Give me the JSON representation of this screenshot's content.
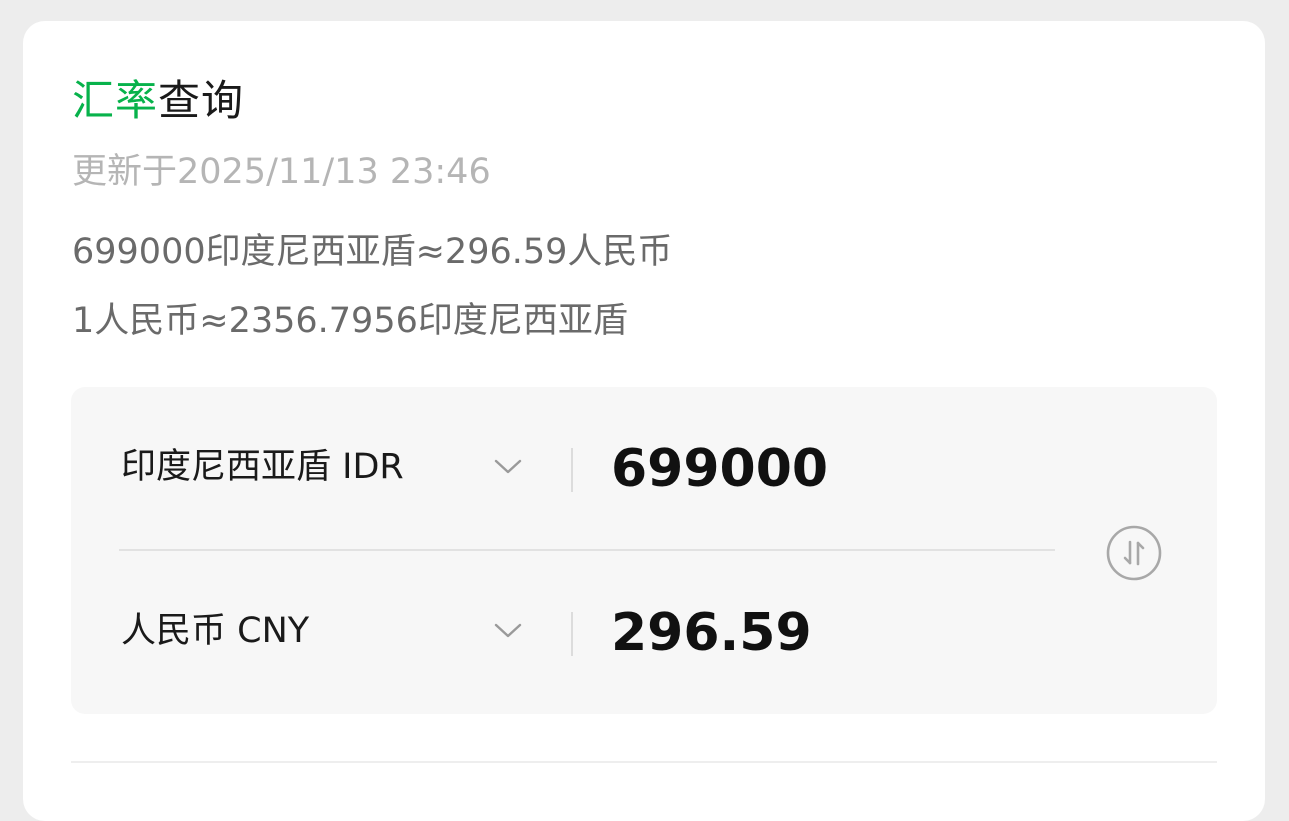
{
  "title": {
    "highlight": "汇率",
    "rest": "查询"
  },
  "updated_text": "更新于2025/11/13 23:46",
  "rates": {
    "line1": "699000印度尼西亚盾≈296.59人民币",
    "line2": "1人民币≈2356.7956印度尼西亚盾"
  },
  "converter": {
    "from": {
      "currency_label": "印度尼西亚盾 IDR",
      "amount": "699000"
    },
    "to": {
      "currency_label": "人民币 CNY",
      "amount": "296.59"
    }
  },
  "icons": {
    "chevron": "chevron-down-icon",
    "swap": "swap-vertical-icon"
  },
  "colors": {
    "accent": "#07b24b",
    "text_primary": "#111111",
    "text_muted": "#b5b5b5",
    "text_secondary": "#6a6a6a",
    "panel_bg": "#f7f7f7"
  }
}
